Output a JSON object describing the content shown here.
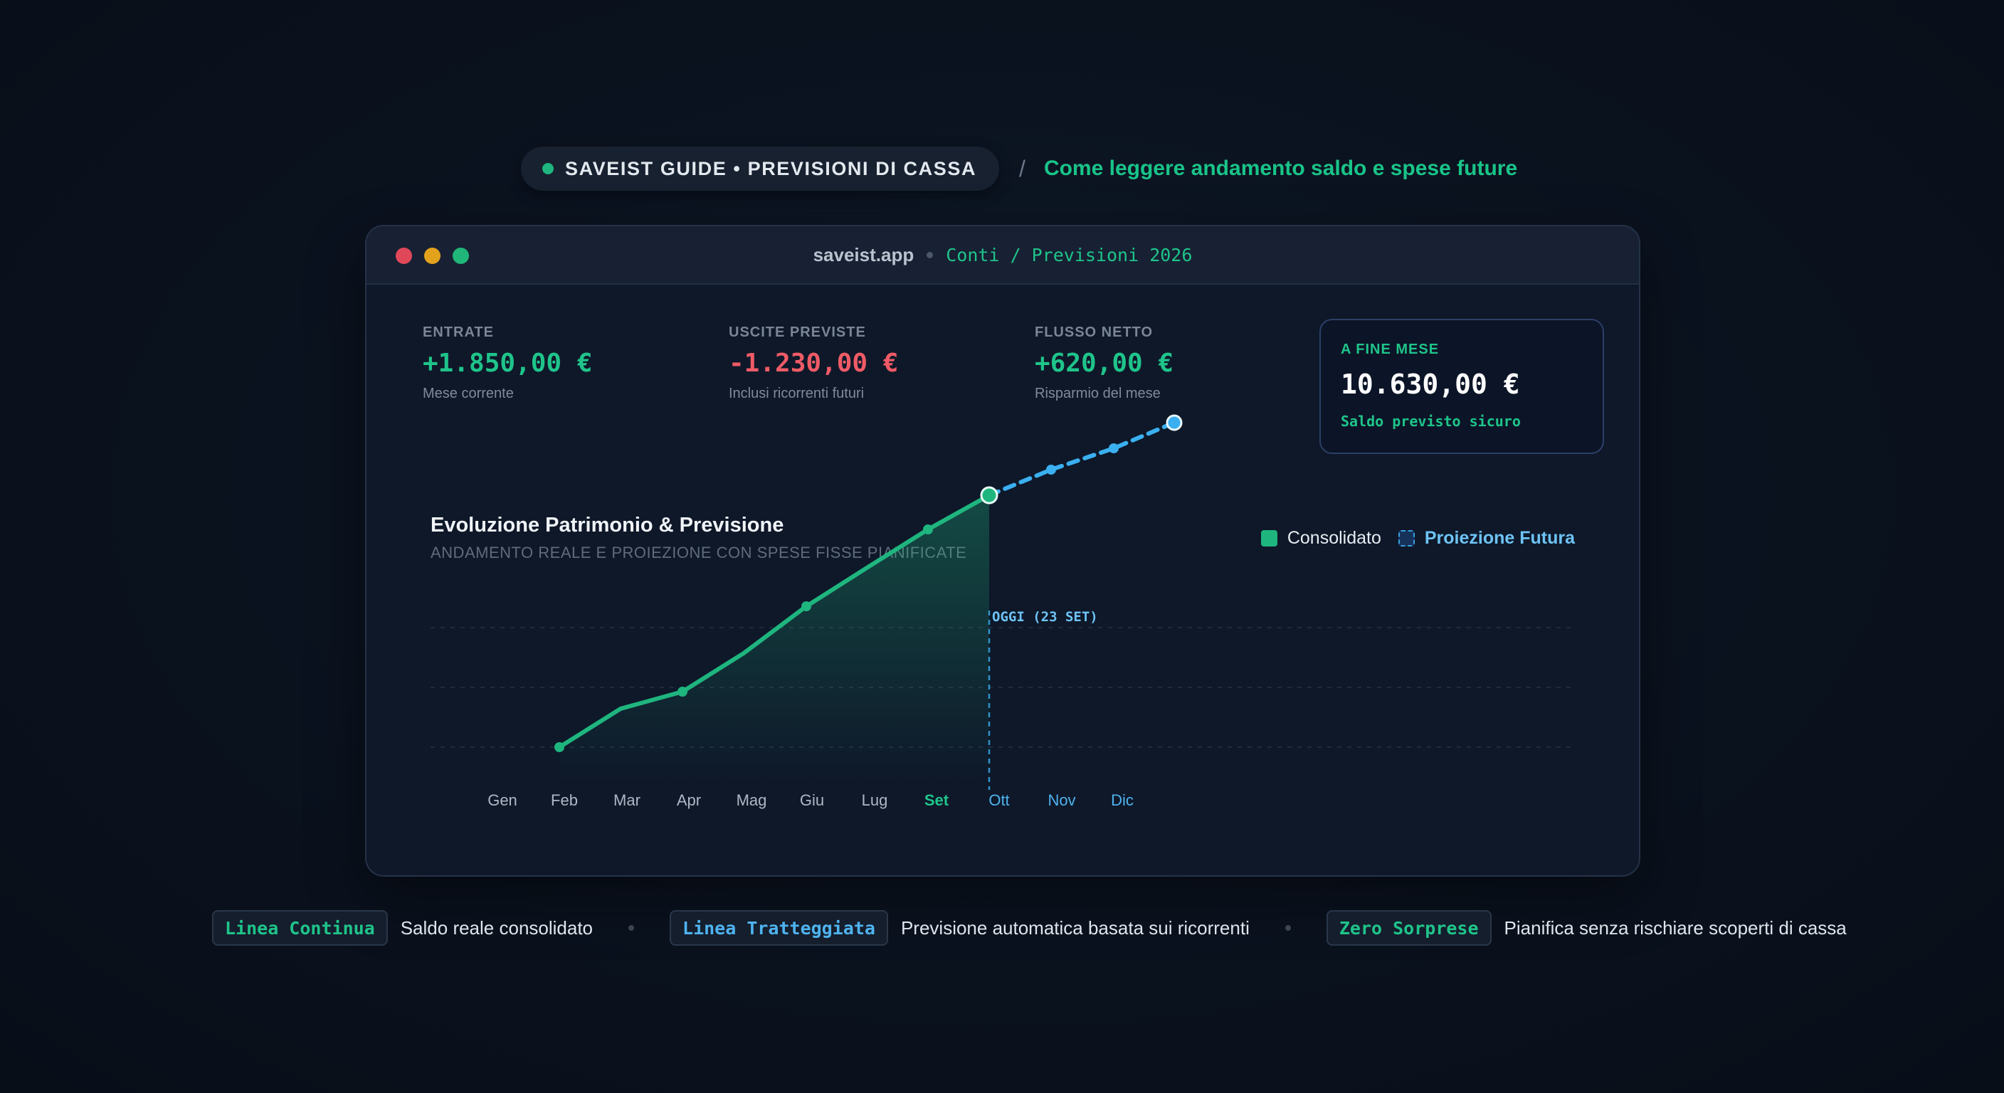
{
  "header": {
    "pill": "SAVEIST GUIDE • PREVISIONI DI CASSA",
    "separator": "/",
    "subtitle": "Come leggere andamento saldo e spese future"
  },
  "window": {
    "domain": "saveist.app",
    "path": "Conti / Previsioni 2026"
  },
  "stats": [
    {
      "label": "ENTRATE",
      "value": "+1.850,00 €",
      "note": "Mese corrente"
    },
    {
      "label": "USCITE PREVISTE",
      "value": "-1.230,00 €",
      "note": "Inclusi ricorrenti futuri"
    },
    {
      "label": "FLUSSO NETTO",
      "value": "+620,00 €",
      "note": "Risparmio del mese"
    },
    {
      "label": "A FINE MESE",
      "value": "10.630,00 €",
      "note": "Saldo previsto sicuro"
    }
  ],
  "chart": {
    "title": "Evoluzione Patrimonio & Previsione",
    "subtitle": "ANDAMENTO REALE E PROIEZIONE CON SPESE FISSE PIANIFICATE",
    "legend": [
      "Consolidato",
      "Proiezione Futura"
    ],
    "today_label": "OGGI (23 SET)"
  },
  "chart_data": {
    "type": "line",
    "categories": [
      "Gen",
      "Feb",
      "Mar",
      "Apr",
      "Mag",
      "Giu",
      "Lug",
      "Set",
      "Ott",
      "Nov",
      "Dic"
    ],
    "series": [
      {
        "name": "Consolidato",
        "values": [
          0,
          0.09,
          0.13,
          0.22,
          0.33,
          0.42,
          0.51,
          0.59,
          null,
          null,
          null
        ]
      },
      {
        "name": "Proiezione Futura",
        "values": [
          null,
          null,
          null,
          null,
          null,
          null,
          null,
          0.59,
          0.65,
          0.7,
          0.76
        ]
      }
    ],
    "today_index": 7,
    "colors": {
      "consolidated": "#1fb57f",
      "projection": "#3ab0f0",
      "today": "#2f93c8"
    }
  },
  "footer": [
    {
      "tag": "Linea Continua",
      "desc": "Saldo reale consolidato"
    },
    {
      "tag": "Linea Tratteggiata",
      "desc": "Previsione automatica basata sui ricorrenti"
    },
    {
      "tag": "Zero Sorprese",
      "desc": "Pianifica senza rischiare scoperti di cassa"
    }
  ]
}
